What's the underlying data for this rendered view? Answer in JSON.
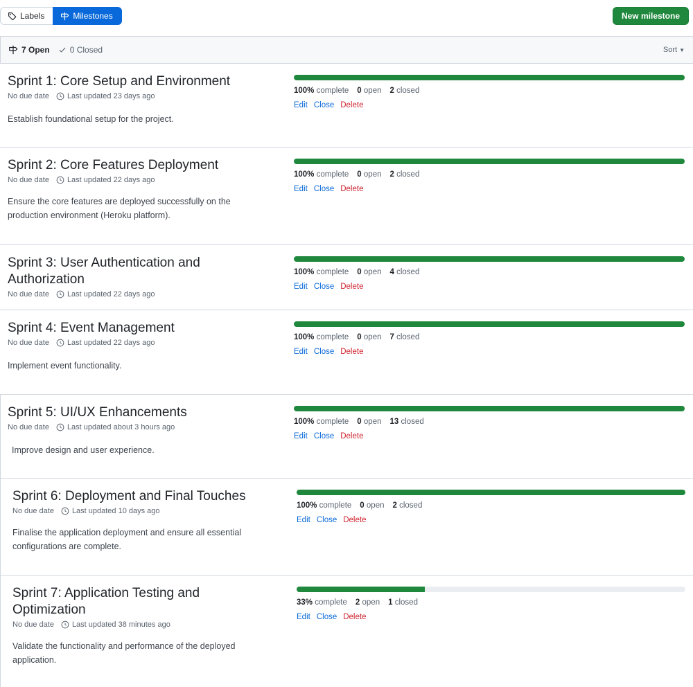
{
  "nav": {
    "labels_label": "Labels",
    "milestones_label": "Milestones",
    "new_milestone_label": "New milestone"
  },
  "filters": {
    "open_label": "7 Open",
    "closed_label": "0 Closed",
    "sort_label": "Sort"
  },
  "action_labels": {
    "edit": "Edit",
    "close": "Close",
    "delete": "Delete"
  },
  "milestones": [
    {
      "title": "Sprint 1: Core Setup and Environment",
      "due": "No due date",
      "updated": "Last updated 23 days ago",
      "description": "Establish foundational setup for the project.",
      "percent": 100,
      "percent_label": "100%",
      "complete_word": "complete",
      "open_count": "0",
      "open_word": "open",
      "closed_count": "2",
      "closed_word": "closed"
    },
    {
      "title": "Sprint 2: Core Features Deployment",
      "due": "No due date",
      "updated": "Last updated 22 days ago",
      "description": "Ensure the core features are deployed successfully on the production environment (Heroku platform).",
      "percent": 100,
      "percent_label": "100%",
      "complete_word": "complete",
      "open_count": "0",
      "open_word": "open",
      "closed_count": "2",
      "closed_word": "closed"
    },
    {
      "title": "Sprint 3: User Authentication and Authorization",
      "due": "No due date",
      "updated": "Last updated 22 days ago",
      "description": "",
      "percent": 100,
      "percent_label": "100%",
      "complete_word": "complete",
      "open_count": "0",
      "open_word": "open",
      "closed_count": "4",
      "closed_word": "closed"
    },
    {
      "title": "Sprint 4: Event Management",
      "due": "No due date",
      "updated": "Last updated 22 days ago",
      "description": "Implement event functionality.",
      "percent": 100,
      "percent_label": "100%",
      "complete_word": "complete",
      "open_count": "0",
      "open_word": "open",
      "closed_count": "7",
      "closed_word": "closed"
    },
    {
      "title": "Sprint 5: UI/UX Enhancements",
      "due": "No due date",
      "updated": "Last updated about 3 hours ago",
      "description": "Improve design and user experience.",
      "percent": 100,
      "percent_label": "100%",
      "complete_word": "complete",
      "open_count": "0",
      "open_word": "open",
      "closed_count": "13",
      "closed_word": "closed"
    },
    {
      "title": "Sprint 6: Deployment and Final Touches",
      "due": "No due date",
      "updated": "Last updated 10 days ago",
      "description": "Finalise the application deployment and ensure all essential configurations are complete.",
      "percent": 100,
      "percent_label": "100%",
      "complete_word": "complete",
      "open_count": "0",
      "open_word": "open",
      "closed_count": "2",
      "closed_word": "closed"
    },
    {
      "title": "Sprint 7: Application Testing and Optimization",
      "due": "No due date",
      "updated": "Last updated 38 minutes ago",
      "description": "Validate the functionality and performance of the deployed application.",
      "percent": 33,
      "percent_label": "33%",
      "complete_word": "complete",
      "open_count": "2",
      "open_word": "open",
      "closed_count": "1",
      "closed_word": "closed"
    }
  ],
  "colors": {
    "primary_blue": "#0969da",
    "success_green": "#1f883d",
    "danger_red": "#cf222e",
    "muted_text": "#59636e",
    "border": "#d0d7de"
  },
  "icons": [
    "tag-icon",
    "milestone-icon",
    "check-icon",
    "clock-icon",
    "caret-down-icon"
  ]
}
